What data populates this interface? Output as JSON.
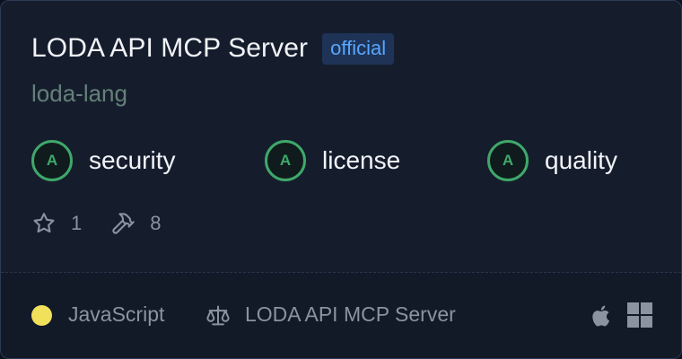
{
  "server": {
    "title": "LODA API MCP Server",
    "badge": "official",
    "owner": "loda-lang"
  },
  "grades": [
    {
      "grade": "A",
      "label": "security"
    },
    {
      "grade": "A",
      "label": "license"
    },
    {
      "grade": "A",
      "label": "quality"
    }
  ],
  "stats": {
    "stars": "1",
    "tools": "8",
    "star_icon": "star-icon",
    "tools_icon": "hammer-icon"
  },
  "footer": {
    "language": "JavaScript",
    "language_color": "#f1e05a",
    "license": "LODA API MCP Server",
    "license_icon": "scale-icon",
    "platforms": [
      "apple-icon",
      "windows-icon"
    ]
  },
  "colors": {
    "grade_accent": "#3fa86a",
    "badge_text": "#58a6ff",
    "badge_bg": "#1e3356"
  }
}
